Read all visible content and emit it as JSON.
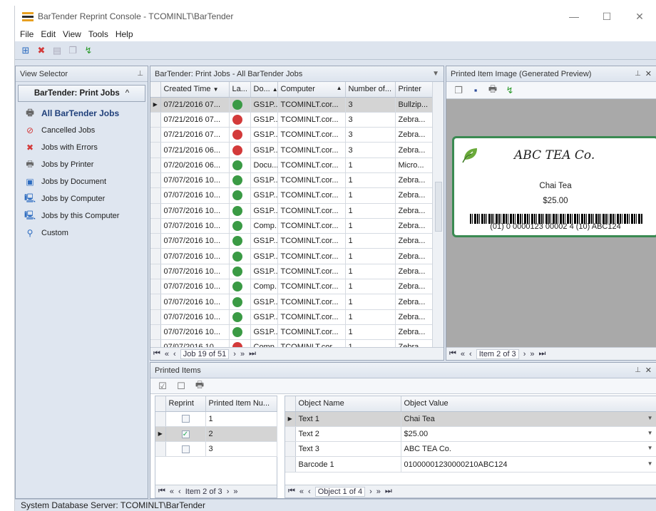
{
  "window": {
    "title": "BarTender Reprint Console - TCOMINLT\\BarTender",
    "minimize": "—",
    "maximize": "☐",
    "close": "✕"
  },
  "menu": [
    "File",
    "Edit",
    "View",
    "Tools",
    "Help"
  ],
  "view_selector": {
    "header": "View Selector",
    "group_label": "BarTender: Print Jobs",
    "items": [
      {
        "label": "All BarTender Jobs",
        "icon": "printer-icon"
      },
      {
        "label": "Cancelled Jobs",
        "icon": "cancel-icon"
      },
      {
        "label": "Jobs with Errors",
        "icon": "error-icon"
      },
      {
        "label": "Jobs by Printer",
        "icon": "printer-icon"
      },
      {
        "label": "Jobs by Document",
        "icon": "document-icon"
      },
      {
        "label": "Jobs by Computer",
        "icon": "computer-icon"
      },
      {
        "label": "Jobs by this Computer",
        "icon": "this-computer-icon"
      },
      {
        "label": "Custom",
        "icon": "magnifier-icon"
      }
    ]
  },
  "jobs": {
    "header": "BarTender: Print Jobs - All BarTender Jobs",
    "columns": [
      "Created Time",
      "La...",
      "Do...",
      "Computer",
      "Number of...",
      "Printer"
    ],
    "rows": [
      {
        "time": "07/21/2016 07...",
        "status": "ok",
        "doc": "GS1P...",
        "computer": "TCOMINLT.cor...",
        "num": "3",
        "printer": "Bullzip..."
      },
      {
        "time": "07/21/2016 07...",
        "status": "cancel",
        "doc": "GS1P...",
        "computer": "TCOMINLT.cor...",
        "num": "3",
        "printer": "Zebra..."
      },
      {
        "time": "07/21/2016 07...",
        "status": "cancel",
        "doc": "GS1P...",
        "computer": "TCOMINLT.cor...",
        "num": "3",
        "printer": "Zebra..."
      },
      {
        "time": "07/21/2016 06...",
        "status": "cancel",
        "doc": "GS1P...",
        "computer": "TCOMINLT.cor...",
        "num": "3",
        "printer": "Zebra..."
      },
      {
        "time": "07/20/2016 06...",
        "status": "ok",
        "doc": "Docu...",
        "computer": "TCOMINLT.cor...",
        "num": "1",
        "printer": "Micro..."
      },
      {
        "time": "07/07/2016 10...",
        "status": "multi",
        "doc": "GS1P...",
        "computer": "TCOMINLT.cor...",
        "num": "1",
        "printer": "Zebra..."
      },
      {
        "time": "07/07/2016 10...",
        "status": "multi",
        "doc": "GS1P...",
        "computer": "TCOMINLT.cor...",
        "num": "1",
        "printer": "Zebra..."
      },
      {
        "time": "07/07/2016 10...",
        "status": "multi",
        "doc": "GS1P...",
        "computer": "TCOMINLT.cor...",
        "num": "1",
        "printer": "Zebra..."
      },
      {
        "time": "07/07/2016 10...",
        "status": "multi",
        "doc": "Comp...",
        "computer": "TCOMINLT.cor...",
        "num": "1",
        "printer": "Zebra..."
      },
      {
        "time": "07/07/2016 10...",
        "status": "multi",
        "doc": "GS1P...",
        "computer": "TCOMINLT.cor...",
        "num": "1",
        "printer": "Zebra..."
      },
      {
        "time": "07/07/2016 10...",
        "status": "multi",
        "doc": "GS1P...",
        "computer": "TCOMINLT.cor...",
        "num": "1",
        "printer": "Zebra..."
      },
      {
        "time": "07/07/2016 10...",
        "status": "multi",
        "doc": "GS1P...",
        "computer": "TCOMINLT.cor...",
        "num": "1",
        "printer": "Zebra..."
      },
      {
        "time": "07/07/2016 10...",
        "status": "multi",
        "doc": "Comp...",
        "computer": "TCOMINLT.cor...",
        "num": "1",
        "printer": "Zebra..."
      },
      {
        "time": "07/07/2016 10...",
        "status": "multi",
        "doc": "GS1P...",
        "computer": "TCOMINLT.cor...",
        "num": "1",
        "printer": "Zebra..."
      },
      {
        "time": "07/07/2016 10...",
        "status": "multi",
        "doc": "GS1P...",
        "computer": "TCOMINLT.cor...",
        "num": "1",
        "printer": "Zebra..."
      },
      {
        "time": "07/07/2016 10...",
        "status": "multi",
        "doc": "GS1P...",
        "computer": "TCOMINLT.cor...",
        "num": "1",
        "printer": "Zebra..."
      },
      {
        "time": "07/07/2016 10...",
        "status": "cancel",
        "doc": "Comp...",
        "computer": "TCOMINLT.cor...",
        "num": "1",
        "printer": "Zebra..."
      }
    ],
    "nav_label": "Job 19 of 51"
  },
  "preview": {
    "header": "Printed Item Image (Generated Preview)",
    "label_company": "ABC TEA Co.",
    "label_product": "Chai Tea",
    "label_price": "$25.00",
    "barcode_text": "(01) 0 0000123 00002 4 (10) ABC124",
    "nav_label": "Item 2 of 3"
  },
  "printed_items": {
    "header": "Printed Items",
    "columns": [
      "Reprint",
      "Printed Item Nu..."
    ],
    "rows": [
      {
        "checked": false,
        "num": "1"
      },
      {
        "checked": true,
        "num": "2"
      },
      {
        "checked": false,
        "num": "3"
      }
    ],
    "nav_label": "Item 2 of 3",
    "object_columns": [
      "Object Name",
      "Object Value"
    ],
    "objects": [
      {
        "name": "Text 1",
        "value": "Chai Tea"
      },
      {
        "name": "Text 2",
        "value": "$25.00"
      },
      {
        "name": "Text 3",
        "value": "ABC TEA Co."
      },
      {
        "name": "Barcode 1",
        "value": "01000001230000210ABC124"
      }
    ],
    "object_nav_label": "Object 1 of 4"
  },
  "status_bar": "System Database Server:  TCOMINLT\\BarTender",
  "colors": {
    "accent": "#1f3f7a",
    "label_border": "#3a8a52",
    "cancel": "#d33a3a",
    "ok": "#3a9a44"
  }
}
